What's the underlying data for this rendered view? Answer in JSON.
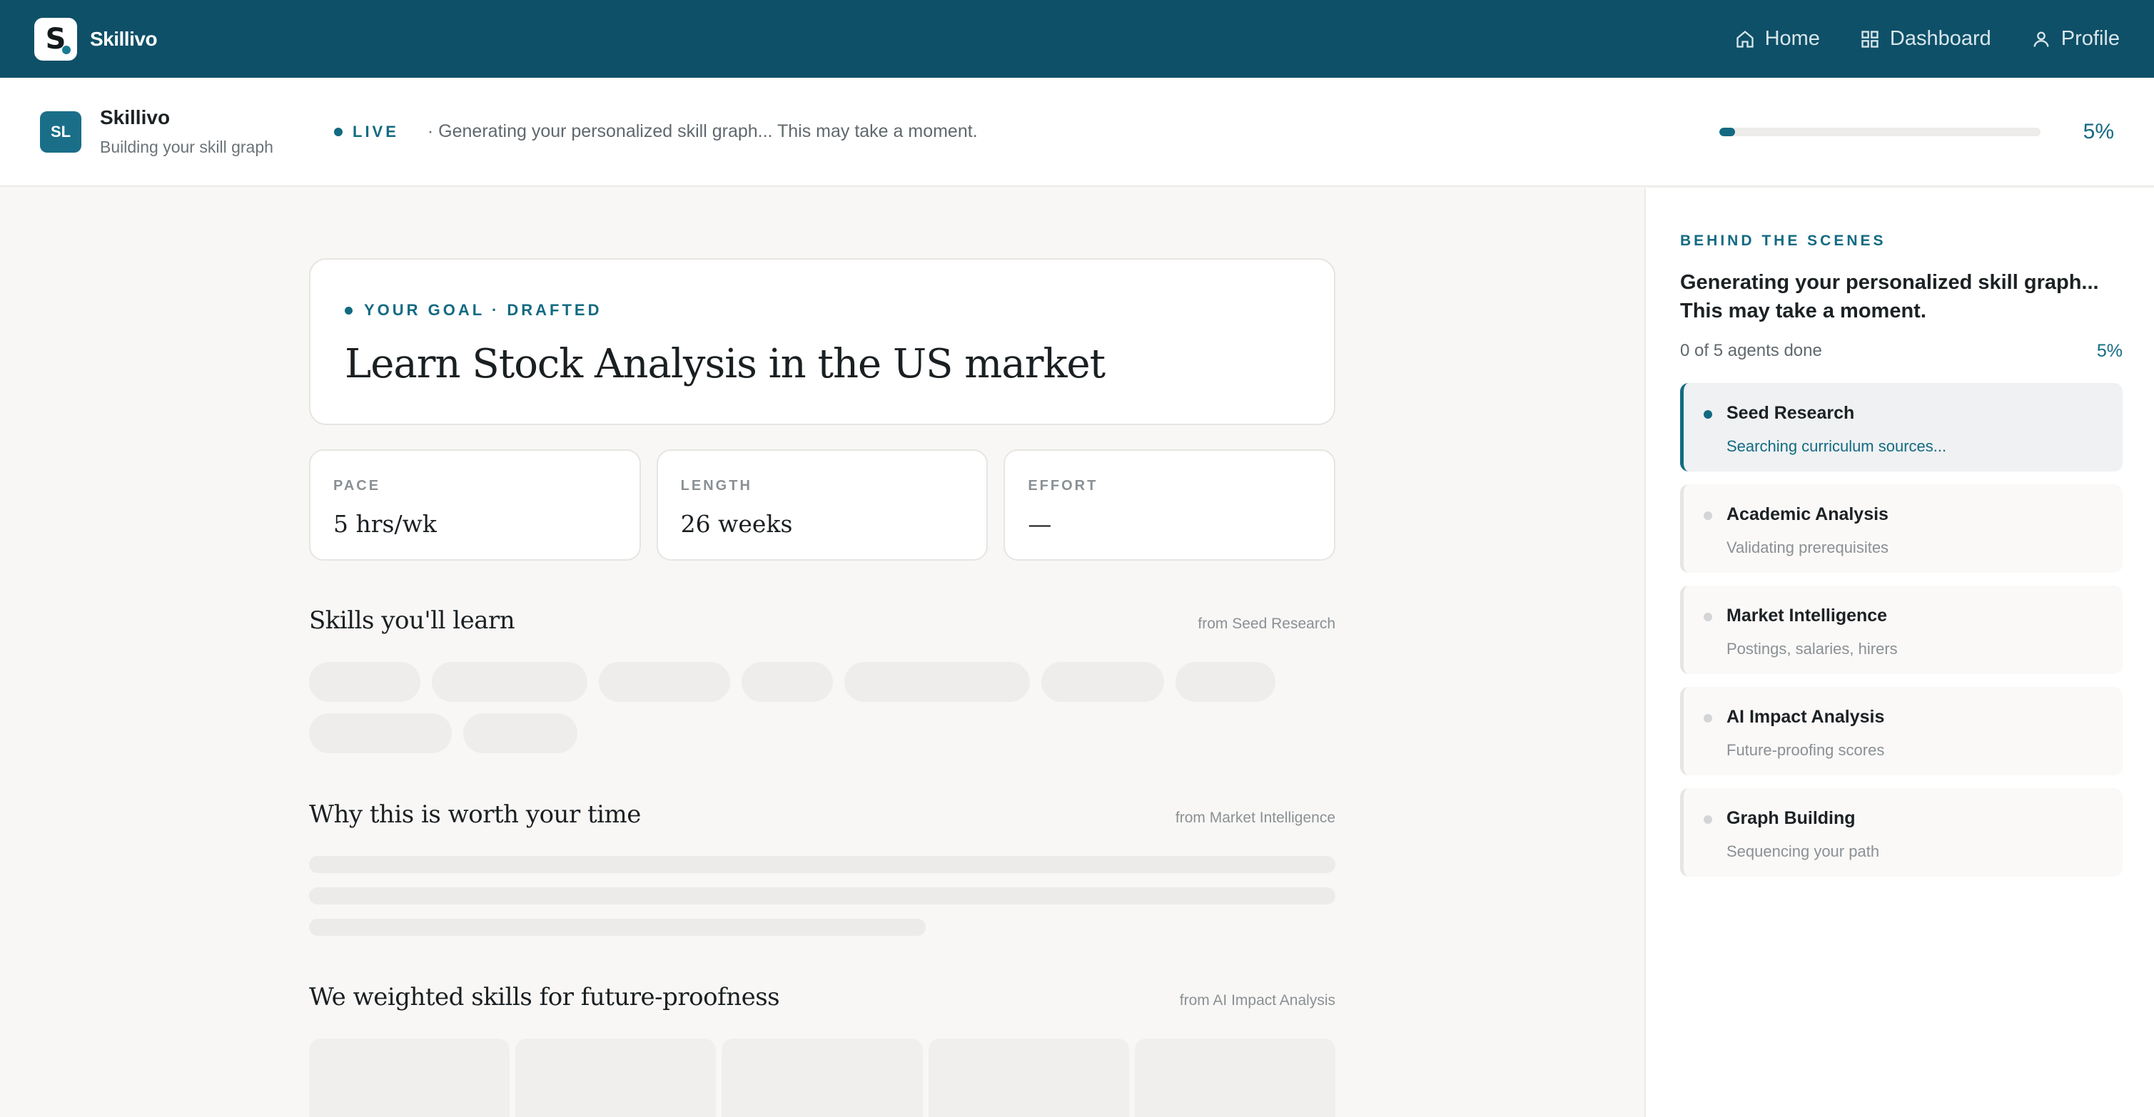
{
  "nav": {
    "brand_letter": "S",
    "brand_name": "Skillivo",
    "items": [
      {
        "label": "Home",
        "icon": "home-icon"
      },
      {
        "label": "Dashboard",
        "icon": "dashboard-icon"
      },
      {
        "label": "Profile",
        "icon": "user-icon"
      }
    ]
  },
  "status": {
    "avatar": "SL",
    "title": "Skillivo",
    "subtitle": "Building your skill graph",
    "live_label": "LIVE",
    "message": "· Generating your personalized skill graph... This may take a moment.",
    "progress_pct": "5%",
    "progress_value": 0.05
  },
  "goal": {
    "eyebrow": "YOUR GOAL · DRAFTED",
    "title": "Learn Stock Analysis in the US market"
  },
  "stats": [
    {
      "label": "PACE",
      "value": "5 hrs/wk"
    },
    {
      "label": "LENGTH",
      "value": "26 weeks"
    },
    {
      "label": "EFFORT",
      "value": "—"
    }
  ],
  "sections": {
    "skills": {
      "title": "Skills you'll learn",
      "source": "from Seed Research"
    },
    "worth": {
      "title": "Why this is worth your time",
      "source": "from Market Intelligence"
    },
    "weighted": {
      "title": "We weighted skills for future-proofness",
      "source": "from AI Impact Analysis"
    }
  },
  "sidebar": {
    "eyebrow": "BEHIND THE SCENES",
    "title": "Generating your personalized skill graph... This may take a moment.",
    "agents_done": "0 of 5 agents done",
    "pct": "5%",
    "agents": [
      {
        "name": "Seed Research",
        "status": "Searching curriculum sources...",
        "active": true
      },
      {
        "name": "Academic Analysis",
        "status": "Validating prerequisites",
        "active": false
      },
      {
        "name": "Market Intelligence",
        "status": "Postings, salaries, hirers",
        "active": false
      },
      {
        "name": "AI Impact Analysis",
        "status": "Future-proofing scores",
        "active": false
      },
      {
        "name": "Graph Building",
        "status": "Sequencing your path",
        "active": false
      }
    ]
  },
  "colors": {
    "nav_bg": "#0e5068",
    "accent": "#136a82"
  }
}
